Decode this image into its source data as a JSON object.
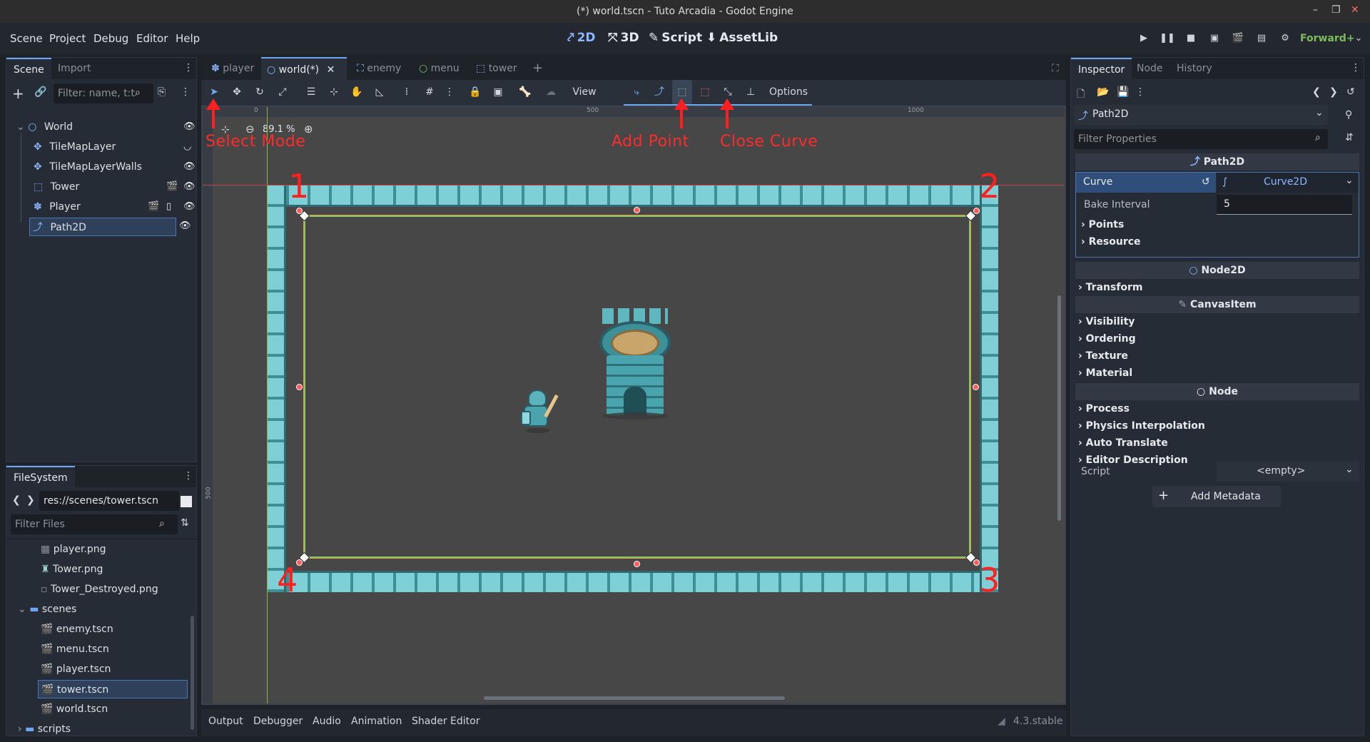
{
  "window": {
    "title": "(*) world.tscn - Tuto Arcadia - Godot Engine"
  },
  "menu": [
    "Scene",
    "Project",
    "Debug",
    "Editor",
    "Help"
  ],
  "workspaces": [
    {
      "label": "2D",
      "icon": "2d-icon"
    },
    {
      "label": "3D",
      "icon": "3d-icon"
    },
    {
      "label": "Script",
      "icon": "script-icon"
    },
    {
      "label": "AssetLib",
      "icon": "assetlib-icon"
    }
  ],
  "renderer": "Forward+",
  "scene_dock": {
    "tabs": [
      "Scene",
      "Import"
    ],
    "filter_placeholder": "Filter: name, t:t",
    "nodes": [
      {
        "label": "World",
        "icon": "node2d-icon"
      },
      {
        "label": "TileMapLayer",
        "icon": "tilemap-icon"
      },
      {
        "label": "TileMapLayerWalls",
        "icon": "tilemap-icon"
      },
      {
        "label": "Tower",
        "icon": "staticbody-icon"
      },
      {
        "label": "Player",
        "icon": "character-icon"
      },
      {
        "label": "Path2D",
        "icon": "path2d-icon"
      }
    ]
  },
  "filesystem": {
    "tab": "FileSystem",
    "path": "res://scenes/tower.tscn",
    "filter_placeholder": "Filter Files",
    "items": [
      "player.png",
      "Tower.png",
      "Tower_Destroyed.png",
      "scenes",
      "enemy.tscn",
      "menu.tscn",
      "player.tscn",
      "tower.tscn",
      "world.tscn",
      "scripts"
    ]
  },
  "scene_tabs": [
    "player",
    "world(*)",
    "enemy",
    "menu",
    "tower"
  ],
  "toolbar": {
    "view": "View",
    "options": "Options",
    "zoom": "89.1 %"
  },
  "ruler": {
    "marks": [
      "0",
      "500",
      "1000"
    ],
    "vmark": "500"
  },
  "annotations": {
    "select_mode": "Select Mode",
    "add_point": "Add Point",
    "close_curve": "Close Curve",
    "corners": [
      "1",
      "2",
      "3",
      "4"
    ]
  },
  "inspector": {
    "tabs": [
      "Inspector",
      "Node",
      "History"
    ],
    "node_name": "Path2D",
    "filter_placeholder": "Filter Properties",
    "section_path2d": "Path2D",
    "curve_label": "Curve",
    "curve_value": "Curve2D",
    "bake_label": "Bake Interval",
    "bake_value": "5",
    "points": "Points",
    "resource": "Resource",
    "section_node2d": "Node2D",
    "transform": "Transform",
    "section_canvas": "CanvasItem",
    "visibility": "Visibility",
    "ordering": "Ordering",
    "texture": "Texture",
    "material": "Material",
    "section_node": "Node",
    "process": "Process",
    "physics": "Physics Interpolation",
    "autotranslate": "Auto Translate",
    "editordesc": "Editor Description",
    "script_label": "Script",
    "script_value": "<empty>",
    "add_metadata": "Add Metadata"
  },
  "bottom_panel": {
    "tabs": [
      "Output",
      "Debugger",
      "Audio",
      "Animation",
      "Shader Editor"
    ],
    "version": "4.3.stable"
  }
}
